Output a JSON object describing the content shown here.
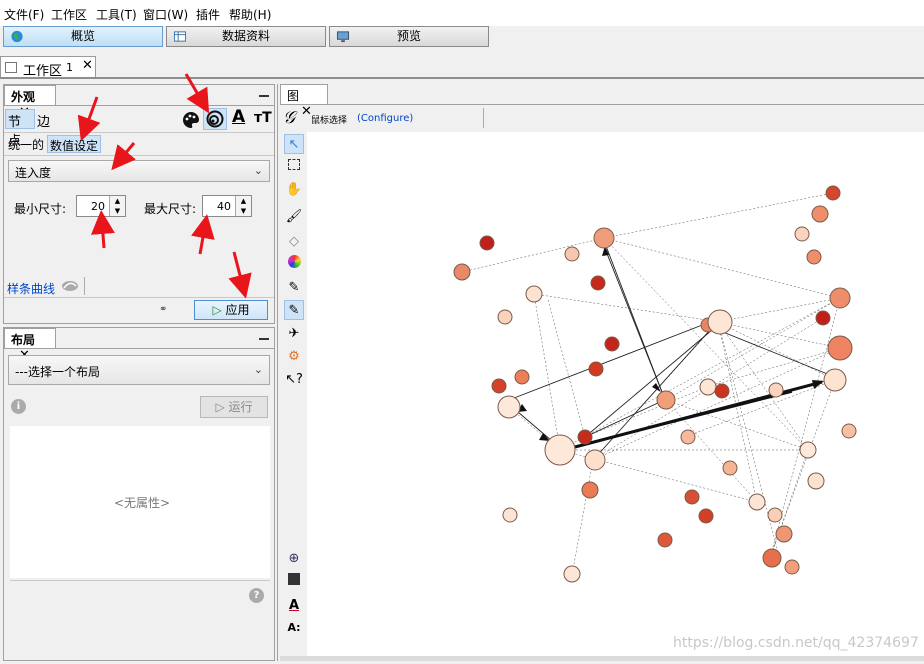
{
  "menu": [
    "文件(F)",
    "工作区",
    "工具(T)",
    "窗口(W)",
    "插件",
    "帮助(H)"
  ],
  "modes": {
    "overview": "概览",
    "data_lab": "数据资料",
    "preview": "预览"
  },
  "workspace_tab": {
    "label": "工作区",
    "index": "1"
  },
  "appearance": {
    "title": "外观",
    "tabs": {
      "nodes": "节点",
      "edges": "边"
    },
    "subtabs": {
      "unique": "统一的",
      "ranking": "数值设定"
    },
    "attribute": "连入度",
    "min_label": "最小尺寸:",
    "min_value": "20",
    "max_label": "最大尺寸:",
    "max_value": "40",
    "spline": "样条曲线",
    "apply": "应用"
  },
  "layout": {
    "title": "布局",
    "select_placeholder": "---选择一个布局",
    "run": "运行",
    "no_properties": "<无属性>"
  },
  "graph": {
    "tab": "图",
    "mouse_select": "鼠标选择",
    "configure": "(Configure)"
  },
  "watermark": "https://blog.csdn.net/qq_42374697",
  "colors": {
    "accent": "#0044cc",
    "node_dark": "#c0201a",
    "node_light": "#fce6d6"
  }
}
